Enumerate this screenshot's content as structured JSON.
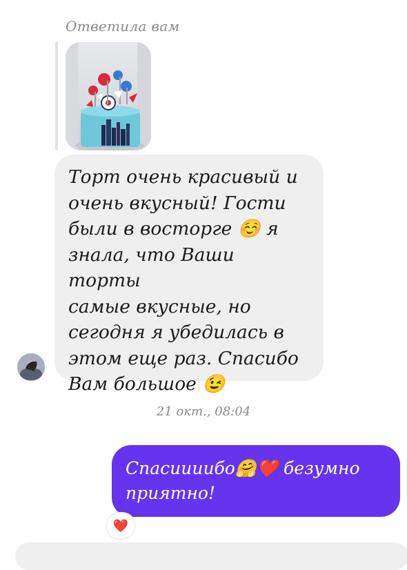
{
  "reply": {
    "label": "Ответила вам"
  },
  "incoming": {
    "text": "Торт очень красивый и\nочень вкусный! Гости\nбыли в восторге ☺️ я\nзнала, что Ваши торты\nсамые вкусные, но\nсегодня я убедилась в\nэтом еще раз. Спасибо\nВам большое 😉"
  },
  "timestamp": "21 окт., 08:04",
  "outgoing": {
    "text": "Спасиииибо🤗❤️ безумно\nприятно!",
    "color": "#6633ee"
  },
  "reaction": {
    "emoji": "❤️"
  }
}
